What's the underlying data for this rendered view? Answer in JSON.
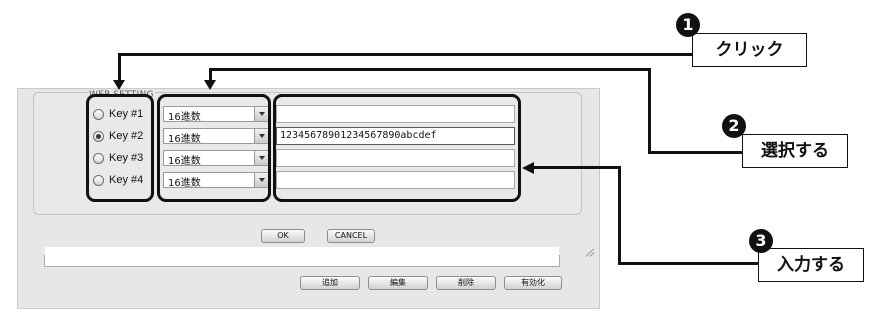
{
  "dialog": {
    "group_label": "WEP SETTING",
    "keys": [
      {
        "label": "Key #1",
        "selected": false,
        "format": "16進数",
        "value": ""
      },
      {
        "label": "Key #2",
        "selected": true,
        "format": "16進数",
        "value": "12345678901234567890abcdef"
      },
      {
        "label": "Key #3",
        "selected": false,
        "format": "16進数",
        "value": ""
      },
      {
        "label": "Key #4",
        "selected": false,
        "format": "16進数",
        "value": ""
      }
    ],
    "ok_label": "OK",
    "cancel_label": "CANCEL",
    "list_buttons": [
      "追加",
      "編集",
      "削除",
      "有効化"
    ]
  },
  "annotations": [
    {
      "number": "1",
      "text": "クリック"
    },
    {
      "number": "2",
      "text": "選択する"
    },
    {
      "number": "3",
      "text": "入力する"
    }
  ],
  "icons": {
    "radio": "radio-button",
    "dropdown": "chevron-down-icon",
    "step_badge": "filled-circle-number"
  }
}
